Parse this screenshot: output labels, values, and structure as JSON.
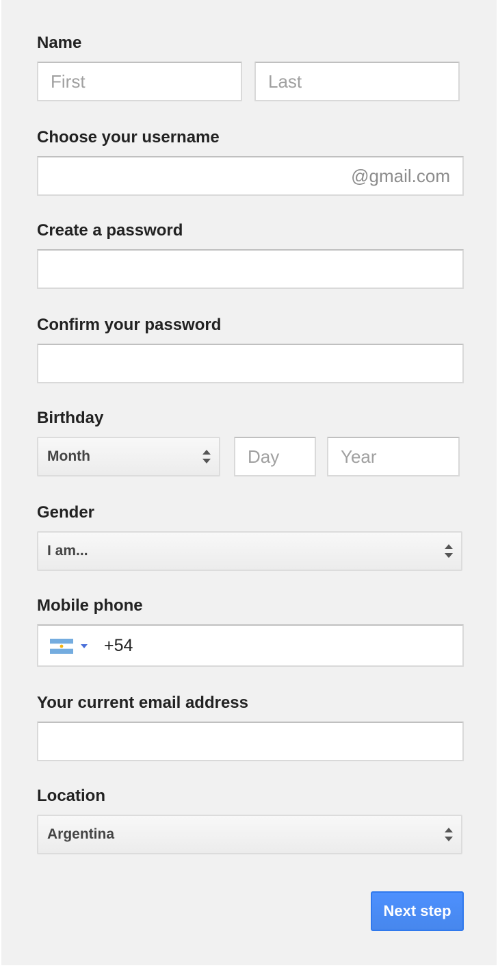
{
  "form": {
    "name": {
      "label": "Name",
      "first_placeholder": "First",
      "last_placeholder": "Last"
    },
    "username": {
      "label": "Choose your username",
      "suffix": "@gmail.com"
    },
    "password": {
      "label": "Create a password"
    },
    "confirm_password": {
      "label": "Confirm your password"
    },
    "birthday": {
      "label": "Birthday",
      "month_value": "Month",
      "day_placeholder": "Day",
      "year_placeholder": "Year"
    },
    "gender": {
      "label": "Gender",
      "value": "I am..."
    },
    "mobile_phone": {
      "label": "Mobile phone",
      "flag_icon": "argentina-flag-icon",
      "value": "+54"
    },
    "current_email": {
      "label": "Your current email address"
    },
    "location": {
      "label": "Location",
      "value": "Argentina"
    },
    "next_button_label": "Next step"
  },
  "colors": {
    "panel_bg": "#f1f1f1",
    "button_bg": "#4d90fe",
    "button_border": "#3079ed",
    "flag_blue": "#74acdf",
    "dropdown_caret": "#4a6fd9"
  }
}
